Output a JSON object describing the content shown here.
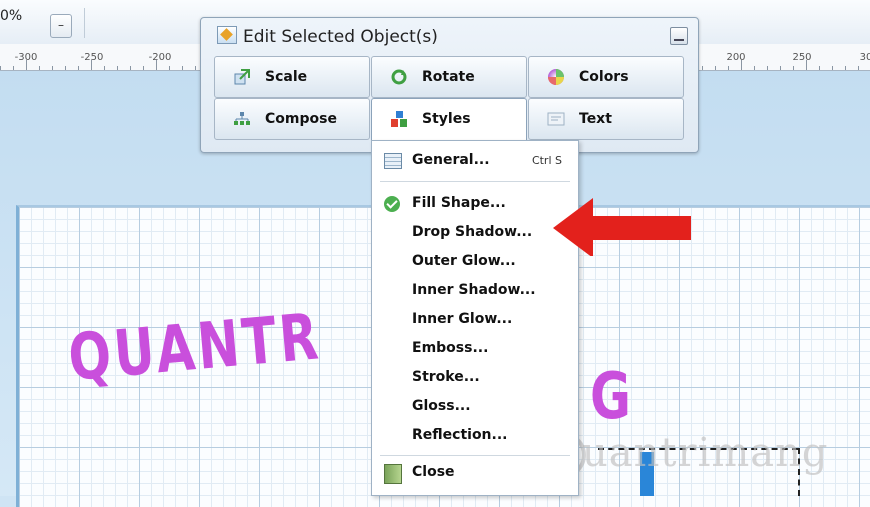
{
  "toolbar": {
    "zoom_text": "0%",
    "zoom_button": "–"
  },
  "ruler": {
    "labels_left": [
      "-300",
      "-250",
      "-200"
    ],
    "labels_right": [
      "200",
      "250",
      "30"
    ]
  },
  "panel": {
    "title": "Edit Selected Object(s)",
    "buttons": [
      {
        "label": "Scale",
        "icon": "scale-icon"
      },
      {
        "label": "Rotate",
        "icon": "rotate-icon"
      },
      {
        "label": "Colors",
        "icon": "colors-icon"
      },
      {
        "label": "Compose",
        "icon": "compose-icon"
      },
      {
        "label": "Styles",
        "icon": "styles-icon"
      },
      {
        "label": "Text",
        "icon": "text-icon"
      }
    ]
  },
  "menu": {
    "general": {
      "label": "General...",
      "shortcut": "Ctrl S"
    },
    "items": [
      "Fill Shape...",
      "Drop Shadow...",
      "Outer Glow...",
      "Inner Shadow...",
      "Inner Glow...",
      "Emboss...",
      "Stroke...",
      "Gloss...",
      "Reflection..."
    ],
    "close": "Close"
  },
  "canvas": {
    "art_text_left": "QUANTR",
    "art_text_right": "G",
    "watermark": "uantrimang"
  },
  "colors": {
    "accent_arrow": "#e3211c",
    "art_text": "#c94fdc"
  }
}
